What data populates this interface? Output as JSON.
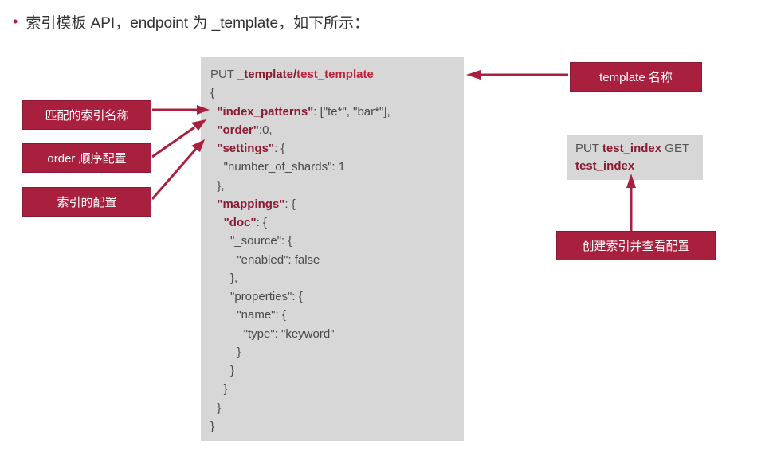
{
  "title": "索引模板 API，endpoint 为 _template，如下所示：",
  "labels": {
    "match": "匹配的索引名称",
    "order": "order 顺序配置",
    "settings": "索引的配置",
    "tplname": "template 名称",
    "create": "创建索引并查看配置"
  },
  "code": {
    "put": "PUT ",
    "tpl_path": "_template",
    "tpl_sep": "/",
    "tpl_name": "test_template",
    "l1": "{",
    "k_patterns": "\"index_patterns\"",
    "v_patterns": ": [\"te*\", \"bar*\"],",
    "k_order": "\"order\"",
    "v_order": ":0,",
    "k_settings": "\"settings\"",
    "v_settings": ": {",
    "l_sh": "    \"number_of_shards\": 1",
    "l_close1": "  },",
    "k_mappings": "\"mappings\"",
    "v_mappings": ": {",
    "k_doc": "\"doc\"",
    "v_doc": ": {",
    "l_src": "      \"_source\": {",
    "l_en": "        \"enabled\": false",
    "l_cb1": "      },",
    "l_props": "      \"properties\": {",
    "l_name": "        \"name\": {",
    "l_type": "          \"type\": \"keyword\"",
    "l_cb2": "        }",
    "l_cb3": "      }",
    "l_cb4": "    }",
    "l_cb5": "  }",
    "l_cb6": "}"
  },
  "code_small": {
    "put": "PUT ",
    "put_idx": "test_index",
    "get": "GET ",
    "get_idx": "test_index"
  }
}
